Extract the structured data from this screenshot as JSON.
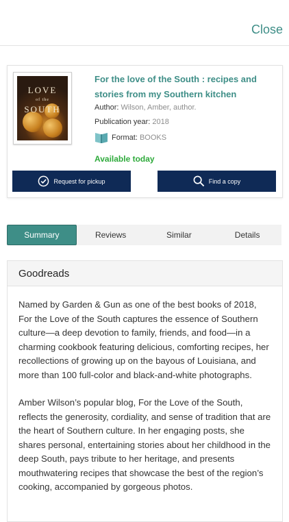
{
  "header": {
    "close_label": "Close"
  },
  "book": {
    "title": "For the love of the South : recipes and stories from my Southern kitchen",
    "author_label": "Author:",
    "author": "Wilson, Amber, author.",
    "year_label": "Publication year:",
    "year": "2018",
    "format_label": "Format:",
    "format": "BOOKS",
    "availability": "Available today",
    "cover_text_top": "LOVE",
    "cover_text_mid": "of the",
    "cover_text_bottom": "SOUTH"
  },
  "actions": {
    "pickup_label": "Request for pickup",
    "find_label": "Find a copy"
  },
  "tabs": [
    {
      "label": "Summary",
      "active": true
    },
    {
      "label": "Reviews",
      "active": false
    },
    {
      "label": "Similar",
      "active": false
    },
    {
      "label": "Details",
      "active": false
    }
  ],
  "review": {
    "heading": "Goodreads",
    "paragraphs": [
      "Named by Garden & Gun as one of the best books of 2018, For the Love of the South captures the essence of Southern culture—a deep devotion to family, friends, and food—in a charming cookbook featuring delicious, comforting recipes, her recollections of growing up on the bayous of Louisiana, and more than 100 full-color and black-and-white photographs.",
      "Amber Wilson’s popular blog, For the Love of the South, reflects the generosity, cordiality, and sense of tradition that are the heart of Southern culture. In her engaging posts, she shares personal, entertaining stories about her childhood in the deep South, pays tribute to her heritage, and presents mouthwatering recipes that showcase the best of the region’s cooking, accompanied by gorgeous photos."
    ]
  },
  "colors": {
    "accent": "#3e8e87",
    "button": "#0f2a56",
    "available": "#2eaa3b",
    "status": "#2ecc71"
  }
}
